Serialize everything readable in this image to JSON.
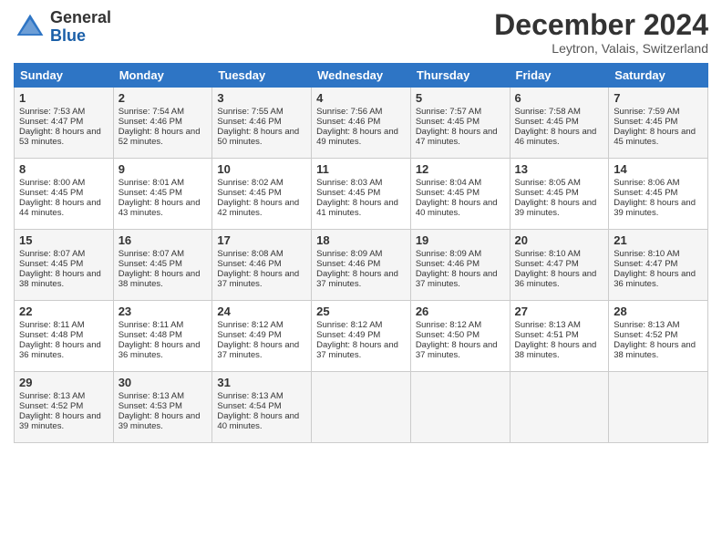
{
  "header": {
    "logo_line1": "General",
    "logo_line2": "Blue",
    "month_title": "December 2024",
    "subtitle": "Leytron, Valais, Switzerland"
  },
  "weekdays": [
    "Sunday",
    "Monday",
    "Tuesday",
    "Wednesday",
    "Thursday",
    "Friday",
    "Saturday"
  ],
  "weeks": [
    [
      {
        "day": "1",
        "sunrise": "Sunrise: 7:53 AM",
        "sunset": "Sunset: 4:47 PM",
        "daylight": "Daylight: 8 hours and 53 minutes."
      },
      {
        "day": "2",
        "sunrise": "Sunrise: 7:54 AM",
        "sunset": "Sunset: 4:46 PM",
        "daylight": "Daylight: 8 hours and 52 minutes."
      },
      {
        "day": "3",
        "sunrise": "Sunrise: 7:55 AM",
        "sunset": "Sunset: 4:46 PM",
        "daylight": "Daylight: 8 hours and 50 minutes."
      },
      {
        "day": "4",
        "sunrise": "Sunrise: 7:56 AM",
        "sunset": "Sunset: 4:46 PM",
        "daylight": "Daylight: 8 hours and 49 minutes."
      },
      {
        "day": "5",
        "sunrise": "Sunrise: 7:57 AM",
        "sunset": "Sunset: 4:45 PM",
        "daylight": "Daylight: 8 hours and 47 minutes."
      },
      {
        "day": "6",
        "sunrise": "Sunrise: 7:58 AM",
        "sunset": "Sunset: 4:45 PM",
        "daylight": "Daylight: 8 hours and 46 minutes."
      },
      {
        "day": "7",
        "sunrise": "Sunrise: 7:59 AM",
        "sunset": "Sunset: 4:45 PM",
        "daylight": "Daylight: 8 hours and 45 minutes."
      }
    ],
    [
      {
        "day": "8",
        "sunrise": "Sunrise: 8:00 AM",
        "sunset": "Sunset: 4:45 PM",
        "daylight": "Daylight: 8 hours and 44 minutes."
      },
      {
        "day": "9",
        "sunrise": "Sunrise: 8:01 AM",
        "sunset": "Sunset: 4:45 PM",
        "daylight": "Daylight: 8 hours and 43 minutes."
      },
      {
        "day": "10",
        "sunrise": "Sunrise: 8:02 AM",
        "sunset": "Sunset: 4:45 PM",
        "daylight": "Daylight: 8 hours and 42 minutes."
      },
      {
        "day": "11",
        "sunrise": "Sunrise: 8:03 AM",
        "sunset": "Sunset: 4:45 PM",
        "daylight": "Daylight: 8 hours and 41 minutes."
      },
      {
        "day": "12",
        "sunrise": "Sunrise: 8:04 AM",
        "sunset": "Sunset: 4:45 PM",
        "daylight": "Daylight: 8 hours and 40 minutes."
      },
      {
        "day": "13",
        "sunrise": "Sunrise: 8:05 AM",
        "sunset": "Sunset: 4:45 PM",
        "daylight": "Daylight: 8 hours and 39 minutes."
      },
      {
        "day": "14",
        "sunrise": "Sunrise: 8:06 AM",
        "sunset": "Sunset: 4:45 PM",
        "daylight": "Daylight: 8 hours and 39 minutes."
      }
    ],
    [
      {
        "day": "15",
        "sunrise": "Sunrise: 8:07 AM",
        "sunset": "Sunset: 4:45 PM",
        "daylight": "Daylight: 8 hours and 38 minutes."
      },
      {
        "day": "16",
        "sunrise": "Sunrise: 8:07 AM",
        "sunset": "Sunset: 4:45 PM",
        "daylight": "Daylight: 8 hours and 38 minutes."
      },
      {
        "day": "17",
        "sunrise": "Sunrise: 8:08 AM",
        "sunset": "Sunset: 4:46 PM",
        "daylight": "Daylight: 8 hours and 37 minutes."
      },
      {
        "day": "18",
        "sunrise": "Sunrise: 8:09 AM",
        "sunset": "Sunset: 4:46 PM",
        "daylight": "Daylight: 8 hours and 37 minutes."
      },
      {
        "day": "19",
        "sunrise": "Sunrise: 8:09 AM",
        "sunset": "Sunset: 4:46 PM",
        "daylight": "Daylight: 8 hours and 37 minutes."
      },
      {
        "day": "20",
        "sunrise": "Sunrise: 8:10 AM",
        "sunset": "Sunset: 4:47 PM",
        "daylight": "Daylight: 8 hours and 36 minutes."
      },
      {
        "day": "21",
        "sunrise": "Sunrise: 8:10 AM",
        "sunset": "Sunset: 4:47 PM",
        "daylight": "Daylight: 8 hours and 36 minutes."
      }
    ],
    [
      {
        "day": "22",
        "sunrise": "Sunrise: 8:11 AM",
        "sunset": "Sunset: 4:48 PM",
        "daylight": "Daylight: 8 hours and 36 minutes."
      },
      {
        "day": "23",
        "sunrise": "Sunrise: 8:11 AM",
        "sunset": "Sunset: 4:48 PM",
        "daylight": "Daylight: 8 hours and 36 minutes."
      },
      {
        "day": "24",
        "sunrise": "Sunrise: 8:12 AM",
        "sunset": "Sunset: 4:49 PM",
        "daylight": "Daylight: 8 hours and 37 minutes."
      },
      {
        "day": "25",
        "sunrise": "Sunrise: 8:12 AM",
        "sunset": "Sunset: 4:49 PM",
        "daylight": "Daylight: 8 hours and 37 minutes."
      },
      {
        "day": "26",
        "sunrise": "Sunrise: 8:12 AM",
        "sunset": "Sunset: 4:50 PM",
        "daylight": "Daylight: 8 hours and 37 minutes."
      },
      {
        "day": "27",
        "sunrise": "Sunrise: 8:13 AM",
        "sunset": "Sunset: 4:51 PM",
        "daylight": "Daylight: 8 hours and 38 minutes."
      },
      {
        "day": "28",
        "sunrise": "Sunrise: 8:13 AM",
        "sunset": "Sunset: 4:52 PM",
        "daylight": "Daylight: 8 hours and 38 minutes."
      }
    ],
    [
      {
        "day": "29",
        "sunrise": "Sunrise: 8:13 AM",
        "sunset": "Sunset: 4:52 PM",
        "daylight": "Daylight: 8 hours and 39 minutes."
      },
      {
        "day": "30",
        "sunrise": "Sunrise: 8:13 AM",
        "sunset": "Sunset: 4:53 PM",
        "daylight": "Daylight: 8 hours and 39 minutes."
      },
      {
        "day": "31",
        "sunrise": "Sunrise: 8:13 AM",
        "sunset": "Sunset: 4:54 PM",
        "daylight": "Daylight: 8 hours and 40 minutes."
      },
      null,
      null,
      null,
      null
    ]
  ]
}
